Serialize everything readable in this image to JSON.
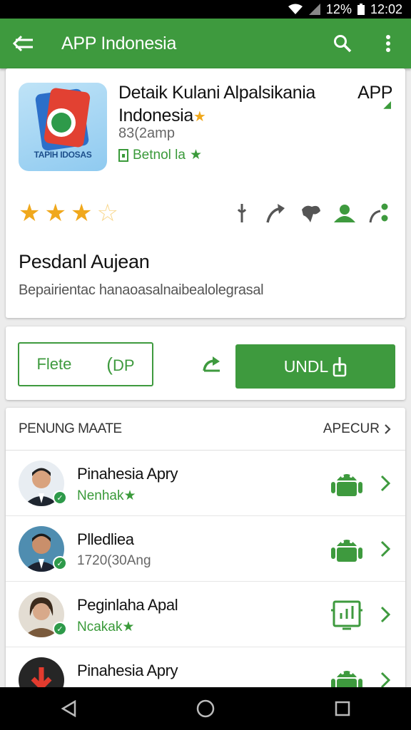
{
  "status_bar": {
    "battery_percent": "12%",
    "time": "12:02"
  },
  "app_bar": {
    "title": "APP Indonesia",
    "icons": [
      "back-arrow-icon",
      "search-icon",
      "more-vert-icon"
    ]
  },
  "app": {
    "icon_text": "TAPIH IDOSAS",
    "title_line1": "Detaik Kulani Alpalsikania",
    "title_tag": "APP",
    "title_line2": "Indonesia",
    "meta": "83(2amp",
    "developer": "Betnol la",
    "rating": 3.5,
    "description_title": "Pesdanl Aujean",
    "description_text": "Bepairientac hanaoasalnaibealolegrasal"
  },
  "actions": {
    "outline_label": "Flete",
    "outline_icon_text": "DP",
    "install_label": "UNDL"
  },
  "list": {
    "header": "PENUNG MAATE",
    "more": "APECUR",
    "items": [
      {
        "title": "Pinahesia Apry",
        "subtitle": "Nenhak",
        "subtitle_star": true,
        "icon": "android-icon"
      },
      {
        "title": "Plledliea",
        "subtitle": "1720(30Ang",
        "subtitle_star": false,
        "icon": "android-icon"
      },
      {
        "title": "Peginlaha Apal",
        "subtitle": "Ncakak",
        "subtitle_star": true,
        "icon": "chart-tablet-icon"
      },
      {
        "title": "Pinahesia Apry",
        "subtitle": "",
        "subtitle_star": false,
        "icon": "android-icon"
      }
    ]
  },
  "colors": {
    "primary": "#3e9a3e",
    "star": "#f0a81c"
  }
}
